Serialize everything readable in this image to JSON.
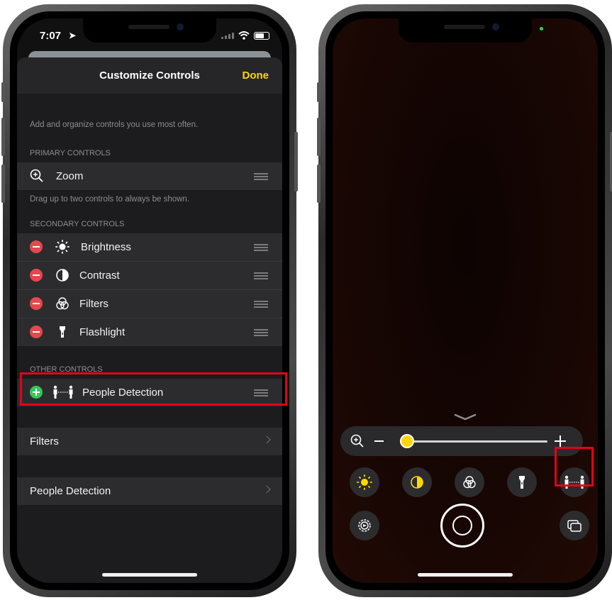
{
  "left_phone": {
    "status": {
      "time": "7:07"
    },
    "nav": {
      "title": "Customize Controls",
      "done_label": "Done"
    },
    "intro_text": "Add and organize controls you use most often.",
    "primary": {
      "header": "PRIMARY CONTROLS",
      "items": [
        {
          "label": "Zoom",
          "icon": "zoom-icon"
        }
      ],
      "footer": "Drag up to two controls to always be shown."
    },
    "secondary": {
      "header": "SECONDARY CONTROLS",
      "items": [
        {
          "label": "Brightness",
          "icon": "brightness-icon"
        },
        {
          "label": "Contrast",
          "icon": "contrast-icon"
        },
        {
          "label": "Filters",
          "icon": "filters-icon"
        },
        {
          "label": "Flashlight",
          "icon": "flashlight-icon"
        }
      ]
    },
    "other": {
      "header": "OTHER CONTROLS",
      "items": [
        {
          "label": "People Detection",
          "icon": "people-detection-icon"
        }
      ]
    },
    "links": [
      {
        "label": "Filters"
      },
      {
        "label": "People Detection"
      }
    ],
    "highlight_color": "#e3001b",
    "accent_color": "#ffd60a"
  },
  "right_phone": {
    "zoom_bar": {
      "zoom_level": 0.05
    },
    "controls": [
      {
        "icon": "brightness-icon"
      },
      {
        "icon": "contrast-icon"
      },
      {
        "icon": "filters-icon"
      },
      {
        "icon": "flashlight-icon"
      },
      {
        "icon": "people-detection-icon"
      }
    ],
    "bottom": [
      {
        "icon": "settings-icon"
      },
      {
        "icon": "capture-shutter"
      },
      {
        "icon": "image-viewer-icon"
      }
    ]
  }
}
